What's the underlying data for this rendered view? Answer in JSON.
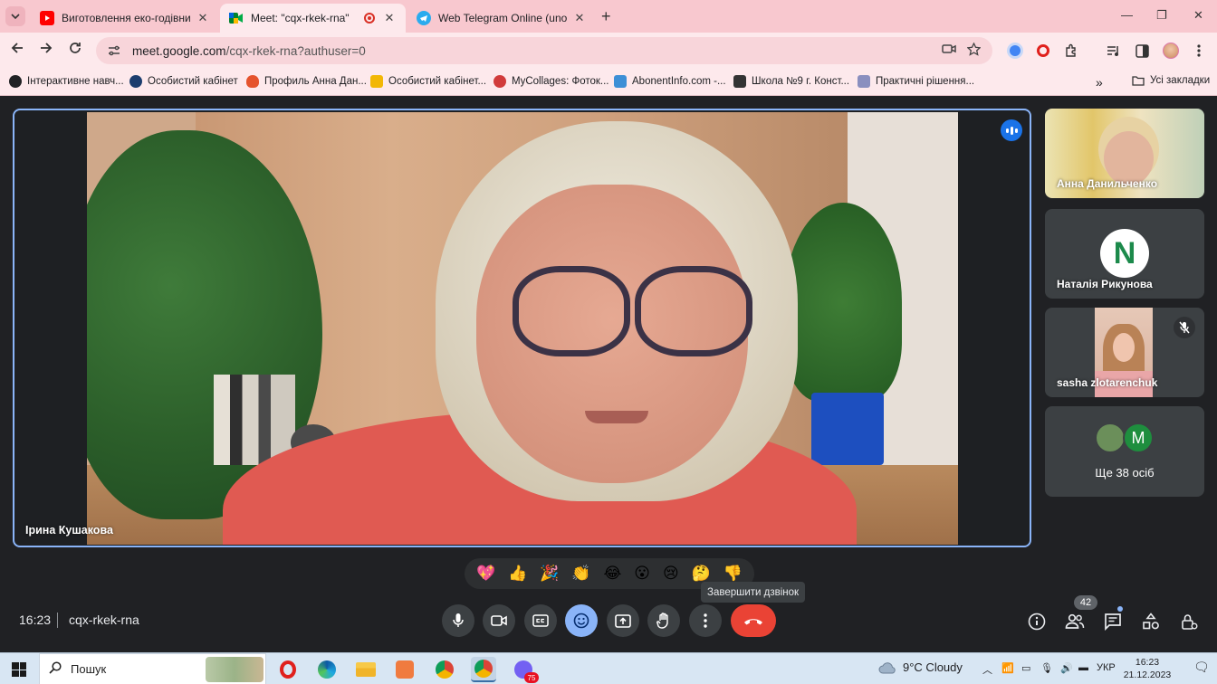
{
  "browser": {
    "tabs": [
      {
        "title": "Виготовлення еко-годівнички",
        "favicon": "youtube-icon",
        "active": false
      },
      {
        "title": "Meet: \"cqx-rkek-rna\"",
        "favicon": "google-meet-icon",
        "active": true
      },
      {
        "title": "Web Telegram Online (unofficial)",
        "favicon": "telegram-icon",
        "active": false
      }
    ],
    "url_host": "meet.google.com",
    "url_path": "/cqx-rkek-rna?authuser=0",
    "bookmarks": [
      {
        "label": "Інтерактивне навч...",
        "color": "#202124"
      },
      {
        "label": "Особистий кабінет",
        "color": "#1c3d6e"
      },
      {
        "label": "Профиль Анна Дан...",
        "color": "#e5532d"
      },
      {
        "label": "Особистий кабінет...",
        "color": "#f2b705"
      },
      {
        "label": "MyCollages: Фоток...",
        "color": "#d13b3b"
      },
      {
        "label": "AbonentInfo.com -...",
        "color": "#3d8fd6"
      },
      {
        "label": "Школа №9 г. Конст...",
        "color": "#333333"
      },
      {
        "label": "Практичні рішення...",
        "color": "#8a8fbf"
      }
    ],
    "all_bookmarks": "Усі закладки"
  },
  "meet": {
    "main_speaker": "Ірина Кушакова",
    "participants": [
      {
        "name": "Анна Данильченко"
      },
      {
        "name": "Наталія Рикунова",
        "avatar_letter": "N"
      },
      {
        "name": "sasha zlotarenchuk",
        "muted": true
      }
    ],
    "more": {
      "avatar_letter": "M",
      "text": "Ще 38 осіб"
    },
    "reactions": [
      "💖",
      "👍",
      "🎉",
      "👏",
      "😂",
      "😮",
      "😢",
      "🤔",
      "👎"
    ],
    "tooltip": "Завершити дзвінок",
    "time": "16:23",
    "meeting_code": "cqx-rkek-rna",
    "people_count": "42",
    "colors": {
      "accent": "#8ab4f8",
      "hangup": "#ea4335",
      "background": "#202124"
    }
  },
  "taskbar": {
    "search_label": "Пошук",
    "weather": "9°C  Cloudy",
    "language": "УКР",
    "time": "16:23",
    "date": "21.12.2023",
    "viber_badge": "75"
  }
}
